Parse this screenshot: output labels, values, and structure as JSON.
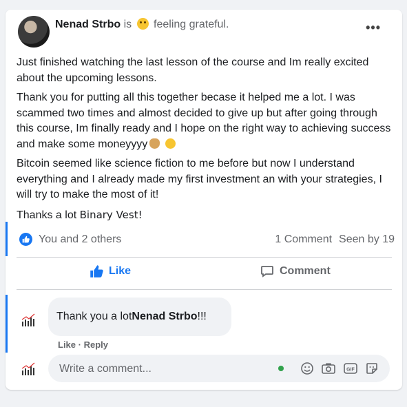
{
  "post": {
    "author": "Nenad Strbo",
    "is": "is",
    "feeling": "feeling grateful.",
    "more": "•••",
    "paragraph1": "Just finished watching the last lesson of the course and Im really excited about the upcoming lessons.",
    "paragraph2": "Thank you for putting all this together becase it helped me a lot. I was scammed two times and almost decided to give up but after going through this course, Im finally ready and I hope on the right way to achieving success and make some moneyyyy",
    "paragraph3": "Bitcoin seemed like science fiction to me before but now I understand everything and I already made my first investment an with your strategies, I will try to make the most of it!",
    "thanks": "Thanks a lot",
    "brand": "Binary Vest",
    "exclaim": "!"
  },
  "reactions": {
    "text": "You and 2 others",
    "comments": "1 Comment",
    "seen": "Seen by 19"
  },
  "actions": {
    "like": "Like",
    "comment": "Comment"
  },
  "comment": {
    "prefix": "Thank you a lot ",
    "mention": "Nenad Strbo",
    "suffix": " !!!",
    "like": "Like",
    "sep": " · ",
    "reply": "Reply"
  },
  "composer": {
    "placeholder": "Write a comment..."
  },
  "colors": {
    "accent": "#1877f2",
    "online": "#31a24c"
  }
}
